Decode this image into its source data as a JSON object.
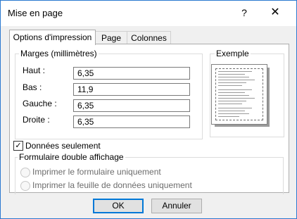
{
  "window": {
    "title": "Mise en page",
    "help_glyph": "?",
    "close_glyph": "✕",
    "accent_color": "#0078d7"
  },
  "tabs": [
    {
      "label": "Options d'impression",
      "active": true
    },
    {
      "label": "Page",
      "active": false
    },
    {
      "label": "Colonnes",
      "active": false
    }
  ],
  "margins": {
    "legend": "Marges (millimètres)",
    "fields": [
      {
        "label": "Haut :",
        "value": "6,35"
      },
      {
        "label": "Bas :",
        "value": "11,9"
      },
      {
        "label": "Gauche :",
        "value": "6,35"
      },
      {
        "label": "Droite :",
        "value": "6,35"
      }
    ]
  },
  "example": {
    "legend": "Exemple"
  },
  "data_only": {
    "label": "Données seulement",
    "checked": true,
    "check_glyph": "✓"
  },
  "split_form": {
    "legend": "Formulaire double affichage",
    "options": [
      {
        "label": "Imprimer le formulaire uniquement",
        "enabled": false
      },
      {
        "label": "Imprimer la feuille de données uniquement",
        "enabled": false
      }
    ]
  },
  "buttons": {
    "ok": "OK",
    "cancel": "Annuler"
  }
}
